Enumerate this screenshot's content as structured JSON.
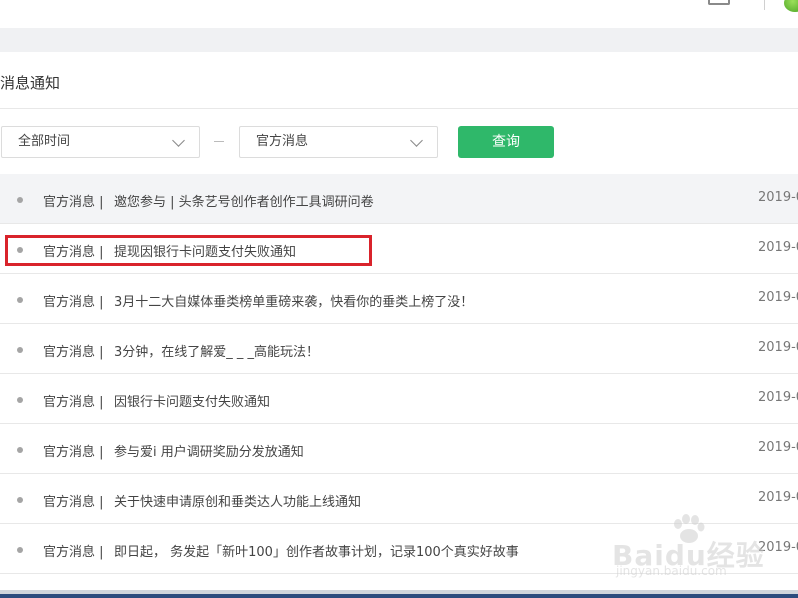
{
  "panel": {
    "title": "消息通知"
  },
  "filters": {
    "time_select": "全部时间",
    "type_select": "官方消息",
    "query_button": "查询"
  },
  "messages": [
    {
      "category": "官方消息 |",
      "text": "邀您参与 | 头条艺号创作者创作工具调研问卷",
      "date": "2019-0"
    },
    {
      "category": "官方消息 |",
      "text": "提现因银行卡问题支付失败通知",
      "date": "2019-0"
    },
    {
      "category": "官方消息 |",
      "text": "3月十二大自媒体垂类榜单重磅来袭，快看你的垂类上榜了没！",
      "date": "2019-0"
    },
    {
      "category": "官方消息 |",
      "text": "3分钟，在线了解爱_ _ _高能玩法！",
      "date": "2019-0"
    },
    {
      "category": "官方消息 |",
      "text": "因银行卡问题支付失败通知",
      "date": "2019-0"
    },
    {
      "category": "官方消息 |",
      "text": "参与爱i 用户调研奖励分发放通知",
      "date": "2019-0"
    },
    {
      "category": "官方消息 |",
      "text": "关于快速申请原创和垂类达人功能上线通知",
      "date": "2019-0"
    },
    {
      "category": "官方消息 |",
      "text": "即日起， 务发起「新叶100」创作者故事计划，记录100个真实好故事",
      "date": "2019-0"
    }
  ],
  "watermark": {
    "text": "Baidu经验",
    "sub": "jingyan.baidu.com"
  },
  "colors": {
    "accent": "#2fb86a",
    "highlight": "#d9232b"
  }
}
